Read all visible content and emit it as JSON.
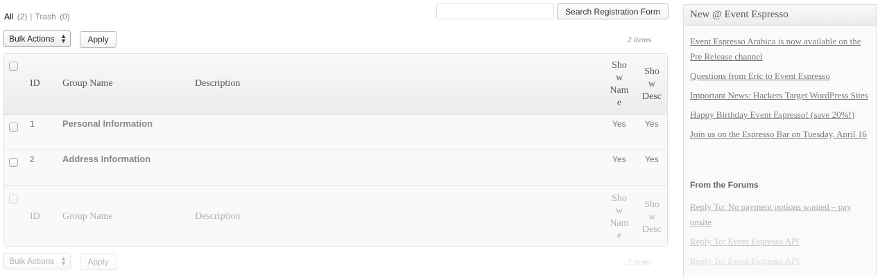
{
  "views": {
    "all_label": "All",
    "all_count": "(2)",
    "separator": "|",
    "trash_label": "Trash",
    "trash_count": "(0)"
  },
  "search": {
    "placeholder": "",
    "button_label": "Search Registration Form"
  },
  "tablenav_top": {
    "bulk_actions": "Bulk Actions",
    "apply_label": "Apply",
    "item_count": "2 items"
  },
  "tablenav_bottom": {
    "bulk_actions": "Bulk Actions",
    "apply_label": "Apply",
    "item_count": "2 items"
  },
  "table": {
    "headers": {
      "id": "ID",
      "group_name": "Group Name",
      "description": "Description",
      "show_name": "Sho w Nam e",
      "show_desc": "Sho w Desc"
    },
    "rows": [
      {
        "id": "1",
        "group_name": "Personal Information",
        "description": "",
        "show_name": "Yes",
        "show_desc": "Yes"
      },
      {
        "id": "2",
        "group_name": "Address Information",
        "description": "",
        "show_name": "Yes",
        "show_desc": "Yes"
      }
    ]
  },
  "sidebar": {
    "title": "New @ Event Espresso",
    "news": [
      "Event Espresso Arabica is now available on the Pre Release channel",
      "Questions from Eric to Event Espresso",
      "Important News: Hackers Target WordPress Sites",
      "Happy Birthday Event Espresso! (save 20%!)",
      "Join us on the Espresso Bar on Tuesday, April 16"
    ],
    "forums_title": "From the Forums",
    "forums": [
      "Reply To: No payment options wanted – pay onsite",
      "Reply To: Event Espresso API",
      "Reply To: Event Espresso API"
    ]
  },
  "colors": {
    "link": "#777777",
    "header_bg": "#ececec",
    "border": "#dfdfdf"
  }
}
